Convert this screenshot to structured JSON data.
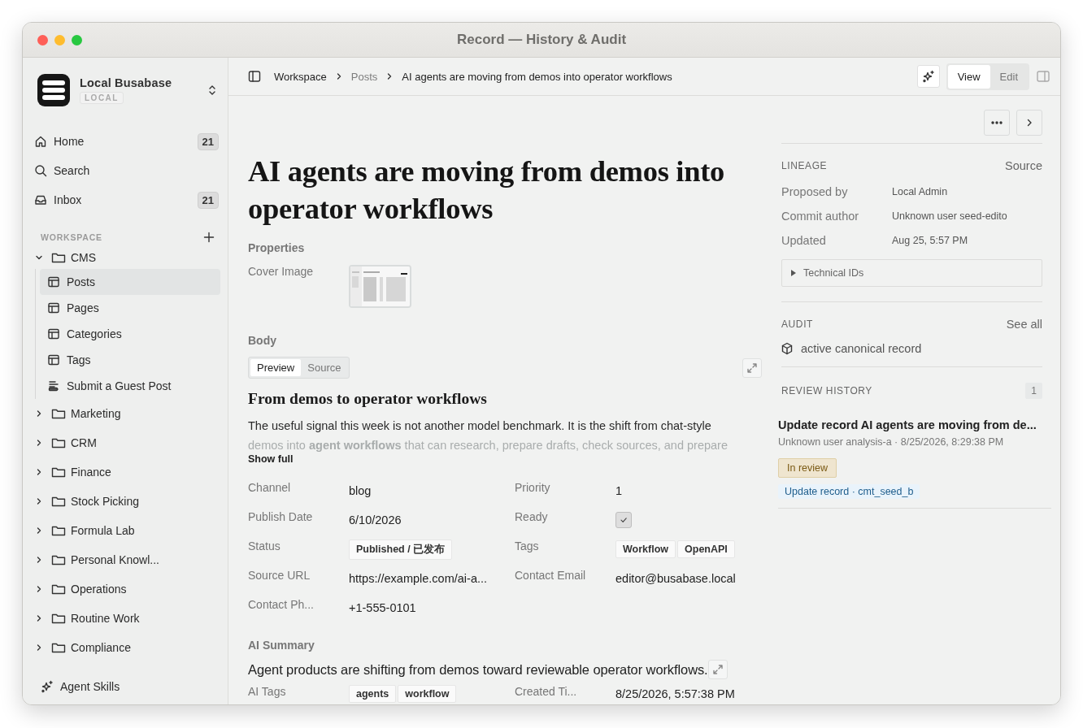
{
  "window": {
    "title": "Record — History & Audit"
  },
  "sidebar": {
    "app_name": "Local Busabase",
    "app_badge": "LOCAL",
    "nav": [
      {
        "kind": "home",
        "label": "Home",
        "count": "21",
        "selected": false
      },
      {
        "kind": "search",
        "label": "Search",
        "selected": false
      },
      {
        "kind": "inbox",
        "label": "Inbox",
        "count": "21",
        "selected": false
      }
    ],
    "section_label": "WORKSPACE",
    "tree": [
      {
        "label": "CMS",
        "expanded": true,
        "selected": false,
        "children": [
          {
            "kind": "table",
            "label": "Posts",
            "selected": true
          },
          {
            "kind": "table",
            "label": "Pages",
            "selected": false
          },
          {
            "kind": "table",
            "label": "Categories",
            "selected": false
          },
          {
            "kind": "table",
            "label": "Tags",
            "selected": false
          },
          {
            "kind": "form",
            "label": "Submit a Guest Post",
            "selected": false
          }
        ]
      },
      {
        "label": "Marketing",
        "expanded": false,
        "selected": false
      },
      {
        "label": "CRM",
        "expanded": false,
        "selected": false
      },
      {
        "label": "Finance",
        "expanded": false,
        "selected": false
      },
      {
        "label": "Stock Picking",
        "expanded": false,
        "selected": false
      },
      {
        "label": "Formula Lab",
        "expanded": false,
        "selected": false
      },
      {
        "label": "Personal Knowl...",
        "expanded": false,
        "selected": false
      },
      {
        "label": "Operations",
        "expanded": false,
        "selected": false
      },
      {
        "label": "Routine Work",
        "expanded": false,
        "selected": false
      },
      {
        "label": "Compliance",
        "expanded": false,
        "selected": false
      }
    ],
    "footer": {
      "label": "Agent Skills"
    }
  },
  "toolbar": {
    "breadcrumbs": [
      {
        "label": "Workspace",
        "muted": false
      },
      {
        "label": "Posts",
        "muted": true
      },
      {
        "label": "AI agents are moving from demos into operator workflows",
        "muted": false
      }
    ],
    "modes": [
      {
        "label": "View",
        "selected": true
      },
      {
        "label": "Edit",
        "selected": false
      }
    ]
  },
  "record": {
    "title": "AI agents are moving from demos into operator workflows",
    "properties_label": "Properties",
    "cover_label": "Cover Image",
    "body_label": "Body",
    "body_tabs": [
      {
        "label": "Preview",
        "selected": true
      },
      {
        "label": "Source",
        "selected": false
      }
    ],
    "body_heading": "From demos to operator workflows",
    "body_lines": [
      {
        "text": "The useful signal this week is not another model benchmark. It is the shift from chat-style",
        "faded": false
      },
      {
        "text": "demos into **agent workflows** that can research, prepare drafts, check sources, and prepare",
        "faded": true
      }
    ],
    "show_full": "Show full",
    "fields": [
      {
        "kind": "text",
        "label": "Channel",
        "value": "blog"
      },
      {
        "kind": "text",
        "label": "Priority",
        "value": "1"
      },
      {
        "kind": "text",
        "label": "Publish Date",
        "value": "6/10/2026"
      },
      {
        "kind": "checkbox",
        "label": "Ready",
        "checked": true
      },
      {
        "kind": "tags",
        "label": "Status",
        "tags": [
          "Published / 已发布"
        ]
      },
      {
        "kind": "tags",
        "label": "Tags",
        "tags": [
          "Workflow",
          "OpenAPI"
        ]
      },
      {
        "kind": "text",
        "label": "Source URL",
        "value": "https://example.com/ai-a..."
      },
      {
        "kind": "text",
        "label": "Contact Email",
        "value": "editor@busabase.local"
      },
      {
        "kind": "text",
        "label": "Contact Ph...",
        "value": "+1-555-0101"
      }
    ],
    "ai_summary_label": "AI Summary",
    "ai_summary": "Agent products are shifting from demos toward reviewable operator workflows.",
    "ai_fields": [
      {
        "kind": "tags",
        "label": "AI Tags",
        "tags": [
          "agents",
          "workflow"
        ]
      },
      {
        "kind": "text",
        "label": "Created Ti...",
        "value": "8/25/2026, 5:57:38 PM"
      }
    ]
  },
  "panel": {
    "lineage": {
      "heading": "LINEAGE",
      "link": "Source",
      "rows": [
        {
          "label": "Proposed by",
          "value": "Local Admin"
        },
        {
          "label": "Commit author",
          "value": "Unknown user seed-edito"
        },
        {
          "label": "Updated",
          "value": "Aug 25, 5:57 PM"
        }
      ],
      "technical_ids": "Technical IDs"
    },
    "audit": {
      "heading": "AUDIT",
      "link": "See all",
      "items": [
        "active canonical record"
      ]
    },
    "review_history": {
      "heading": "REVIEW HISTORY",
      "count": "1",
      "entries": [
        {
          "title": "Update record AI agents are moving from de...",
          "meta": "Unknown user analysis-a · 8/25/2026, 8:29:38 PM",
          "status": "In review",
          "commit": "Update record · cmt_seed_b"
        }
      ]
    }
  }
}
